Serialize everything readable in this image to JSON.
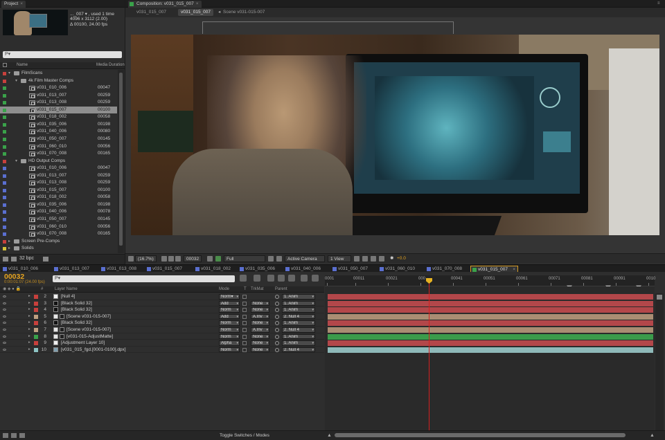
{
  "project": {
    "tab": "Project",
    "info": {
      "name": "..._007 ▾ , used 1 time",
      "size": "4096 x 3112 (2.00)",
      "duration": "Δ 00100, 24.00 fps"
    },
    "search_placeholder": "P▾",
    "columns": {
      "name": "Name",
      "duration": "Media Duration"
    },
    "tree": [
      {
        "kind": "folder",
        "level": 0,
        "name": "FilmScans",
        "label": "#c8403c"
      },
      {
        "kind": "folder",
        "level": 1,
        "name": "4k Film Master Comps",
        "label": "#c8403c"
      },
      {
        "kind": "comp",
        "level": 2,
        "name": "v031_010_006",
        "dur": "00047",
        "label": "#3aa24a"
      },
      {
        "kind": "comp",
        "level": 2,
        "name": "v031_013_007",
        "dur": "00259",
        "label": "#3aa24a"
      },
      {
        "kind": "comp",
        "level": 2,
        "name": "v031_013_008",
        "dur": "00259",
        "label": "#3aa24a"
      },
      {
        "kind": "comp",
        "level": 2,
        "name": "v031_015_007",
        "dur": "00100",
        "label": "#3aa24a",
        "selected": true
      },
      {
        "kind": "comp",
        "level": 2,
        "name": "v031_018_002",
        "dur": "00058",
        "label": "#3aa24a"
      },
      {
        "kind": "comp",
        "level": 2,
        "name": "v031_035_006",
        "dur": "00198",
        "label": "#3aa24a"
      },
      {
        "kind": "comp",
        "level": 2,
        "name": "v031_040_006",
        "dur": "00080",
        "label": "#3aa24a"
      },
      {
        "kind": "comp",
        "level": 2,
        "name": "v031_050_007",
        "dur": "00145",
        "label": "#3aa24a"
      },
      {
        "kind": "comp",
        "level": 2,
        "name": "v031_060_010",
        "dur": "00056",
        "label": "#3aa24a"
      },
      {
        "kind": "comp",
        "level": 2,
        "name": "v031_070_008",
        "dur": "00165",
        "label": "#3aa24a"
      },
      {
        "kind": "folder",
        "level": 1,
        "name": "HD Output Comps",
        "label": "#c8403c"
      },
      {
        "kind": "comp",
        "level": 2,
        "name": "v031_010_006",
        "dur": "00047",
        "label": "#5a6fd0"
      },
      {
        "kind": "comp",
        "level": 2,
        "name": "v031_013_007",
        "dur": "00259",
        "label": "#5a6fd0"
      },
      {
        "kind": "comp",
        "level": 2,
        "name": "v031_013_008",
        "dur": "00259",
        "label": "#5a6fd0"
      },
      {
        "kind": "comp",
        "level": 2,
        "name": "v031_015_007",
        "dur": "00100",
        "label": "#5a6fd0"
      },
      {
        "kind": "comp",
        "level": 2,
        "name": "v031_018_002",
        "dur": "00058",
        "label": "#5a6fd0"
      },
      {
        "kind": "comp",
        "level": 2,
        "name": "v031_035_006",
        "dur": "00198",
        "label": "#5a6fd0"
      },
      {
        "kind": "comp",
        "level": 2,
        "name": "v031_040_006",
        "dur": "00078",
        "label": "#5a6fd0"
      },
      {
        "kind": "comp",
        "level": 2,
        "name": "v031_050_007",
        "dur": "00145",
        "label": "#5a6fd0"
      },
      {
        "kind": "comp",
        "level": 2,
        "name": "v031_060_010",
        "dur": "00056",
        "label": "#5a6fd0"
      },
      {
        "kind": "comp",
        "level": 2,
        "name": "v031_070_008",
        "dur": "00165",
        "label": "#5a6fd0"
      },
      {
        "kind": "folder",
        "level": 0,
        "name": "Screen Pre-Comps",
        "label": "#c8403c",
        "collapsed": true
      },
      {
        "kind": "folder",
        "level": 0,
        "name": "Solids",
        "label": "#d4c23a",
        "collapsed": true
      }
    ],
    "bpc": "32 bpc"
  },
  "composition": {
    "tab": "Composition: v031_015_007",
    "crumbs": [
      "v031_015_007",
      "v031_015_007",
      "Scene v031-015-007"
    ],
    "viewer_bar": {
      "zoom": "(16.7%)",
      "frame": "00032",
      "resolution": "Full",
      "camera": "Active Camera",
      "view": "1 View",
      "exposure": "+0.0"
    }
  },
  "comp_tabs": [
    "v031_010_006",
    "v031_013_007",
    "v031_013_008",
    "v031_015_007",
    "v031_018_002",
    "v031_035_006",
    "v031_040_006",
    "v031_050_007",
    "v031_060_010",
    "v031_070_008",
    "v031_015_007"
  ],
  "timeline": {
    "timecode": "00032",
    "timecode_sub": "0:00:01:07 (24.00 fps)",
    "search_placeholder": "P▾",
    "columns": {
      "hash": "#",
      "layer_name": "Layer Name",
      "mode": "Mode",
      "t": "T",
      "trkmat": "TrkMat",
      "parent": "Parent"
    },
    "ruler": [
      "0001",
      "00011",
      "00021",
      "000",
      "00041",
      "00051",
      "00061",
      "00071",
      "00081",
      "00091",
      "0010"
    ],
    "layers": [
      {
        "num": "2",
        "name": "[Null 4]",
        "label": "#c8403c",
        "mode": "Norm▾",
        "trkmat": "",
        "parent": "1. Anim",
        "bar": "#b3474a",
        "swatch": "#f0f0f0"
      },
      {
        "num": "3",
        "name": "[Black Solid 32]",
        "label": "#c8403c",
        "mode": "Add",
        "trkmat": "None",
        "parent": "1. Anim",
        "bar": "#b3474a",
        "swatch": "#111"
      },
      {
        "num": "4",
        "name": "[Black Solid 32]",
        "label": "#c8403c",
        "mode": "Norm",
        "trkmat": "None",
        "parent": "1. Anim",
        "bar": "#b3474a",
        "swatch": "#111"
      },
      {
        "num": "5",
        "name": "[Scene v031-015-007]",
        "label": "#c0a081",
        "mode": "Add",
        "trkmat": "A.Inv",
        "parent": "2. Null 4",
        "bar": "#a98d73",
        "swatch": "comp"
      },
      {
        "num": "6",
        "name": "[Black Solid 32]",
        "label": "#c8403c",
        "mode": "Norm",
        "trkmat": "None",
        "parent": "1. Anim",
        "bar": "#b3474a",
        "swatch": "#111"
      },
      {
        "num": "7",
        "name": "[Scene v031-015-007]",
        "label": "#c0a081",
        "mode": "Norm",
        "trkmat": "A.Inv",
        "parent": "2. Null 4",
        "bar": "#a98d73",
        "swatch": "comp"
      },
      {
        "num": "8",
        "name": "[v031-015-AdjustMatte]",
        "label": "#3aa24a",
        "mode": "Norm",
        "trkmat": "None",
        "parent": "1. Anim",
        "bar": "#3b9b4b",
        "swatch": "comp"
      },
      {
        "num": "9",
        "name": "[Adjustment Layer 10]",
        "label": "#c8403c",
        "mode": "Alpha",
        "trkmat": "None",
        "parent": "1. Anim",
        "bar": "#b3474a",
        "swatch": "#f0f0f0"
      },
      {
        "num": "10",
        "name": "[v031_015_fgd.[0001-0100].dpx]",
        "label": "#8dc4c4",
        "mode": "Norm",
        "trkmat": "None",
        "parent": "2. Null 4",
        "bar": "#8fb9b9",
        "swatch": "footage"
      }
    ],
    "toggle_label": "Toggle Switches / Modes",
    "playhead_frame": 32
  }
}
